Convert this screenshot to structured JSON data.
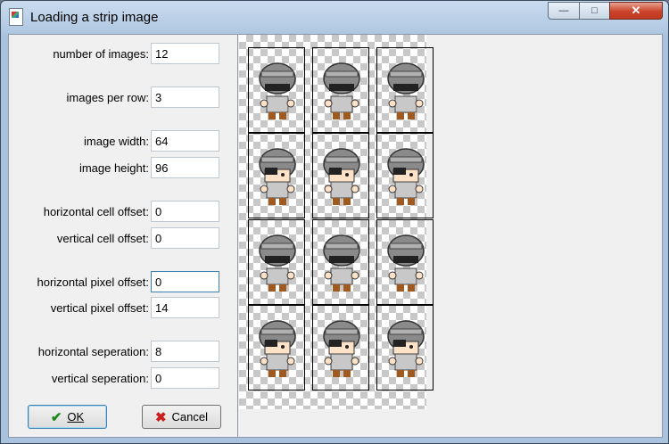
{
  "window": {
    "title": "Loading a strip image",
    "minimize": "—",
    "maximize": "□",
    "close": "✕"
  },
  "fields": [
    {
      "label": "number of images:",
      "value": "12"
    },
    {
      "label": "images per row:",
      "value": "3"
    },
    {
      "label": "image width:",
      "value": "64"
    },
    {
      "label": "image height:",
      "value": "96"
    },
    {
      "label": "horizontal cell offset:",
      "value": "0"
    },
    {
      "label": "vertical cell offset:",
      "value": "0"
    },
    {
      "label": "horizontal pixel offset:",
      "value": "0"
    },
    {
      "label": "vertical pixel offset:",
      "value": "14"
    },
    {
      "label": "horizontal seperation:",
      "value": "8"
    },
    {
      "label": "vertical seperation:",
      "value": "0"
    }
  ],
  "buttons": {
    "ok": "OK",
    "cancel": "Cancel"
  },
  "preview": {
    "columns": 3,
    "rows": 4,
    "frame_count": 12
  },
  "icons": {
    "ok": "check-icon",
    "cancel": "x-icon",
    "app": "app-icon"
  }
}
